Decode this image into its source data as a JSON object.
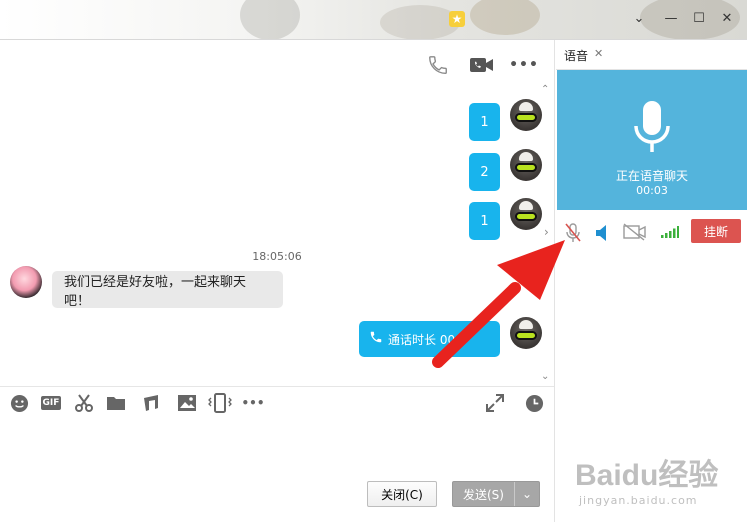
{
  "window": {
    "controls": [
      "⌄",
      "—",
      "☐",
      "✕"
    ]
  },
  "chat": {
    "messages_out_numbers": [
      "1",
      "2",
      "1"
    ],
    "timestamp": "18:05:06",
    "message_in": "我们已经是好友啦，一起来聊天吧！",
    "call_bubble": "通话时长 00:0"
  },
  "toolbar": {
    "gif_label": "GIF",
    "more_label": "•••"
  },
  "buttons": {
    "close": "关闭(C)",
    "send": "发送(S)",
    "send_dropdown": "⌄"
  },
  "voice": {
    "tab_label": "语音",
    "tab_close": "✕",
    "status": "正在语音聊天",
    "duration": "00:03",
    "hangup": "挂断"
  },
  "watermark": {
    "brand": "Baidu经验",
    "url": "jingyan.baidu.com"
  },
  "colors": {
    "bubble": "#18b4ed",
    "voice_panel": "#54b4dc",
    "hangup": "#dc5450",
    "arrow": "#e8231e"
  },
  "icons": [
    "phone-icon",
    "video-icon",
    "more-icon",
    "emoji-icon",
    "gif-icon",
    "scissors-icon",
    "folder-icon",
    "music-icon",
    "image-icon",
    "shake-icon",
    "expand-icon",
    "history-clock-icon",
    "microphone-icon",
    "mic-muted-icon",
    "speaker-icon",
    "camera-off-icon",
    "signal-icon"
  ]
}
